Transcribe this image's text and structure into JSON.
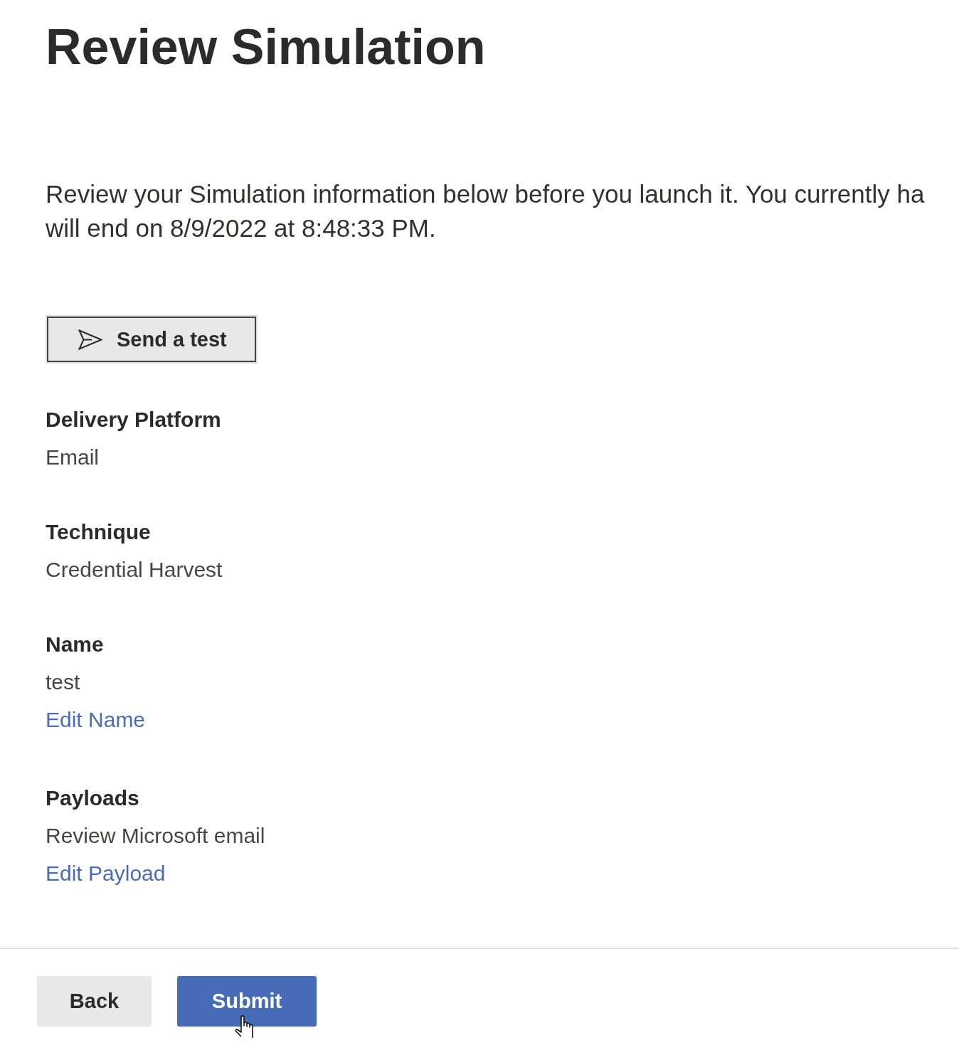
{
  "page": {
    "title": "Review Simulation",
    "description_lines": [
      "Review your Simulation information below before you launch it. You currently ha",
      "will end on 8/9/2022 at 8:48:33 PM."
    ]
  },
  "send_test_button": {
    "label": "Send a test"
  },
  "sections": [
    {
      "label": "Delivery Platform",
      "value": "Email"
    },
    {
      "label": "Technique",
      "value": "Credential Harvest"
    },
    {
      "label": "Name",
      "value": "test",
      "edit_link": "Edit Name"
    },
    {
      "label": "Payloads",
      "value": "Review Microsoft email",
      "edit_link": "Edit Payload"
    }
  ],
  "footer": {
    "buttons": [
      {
        "label": "Back",
        "kind": "secondary"
      },
      {
        "label": "Submit",
        "kind": "primary"
      }
    ]
  }
}
